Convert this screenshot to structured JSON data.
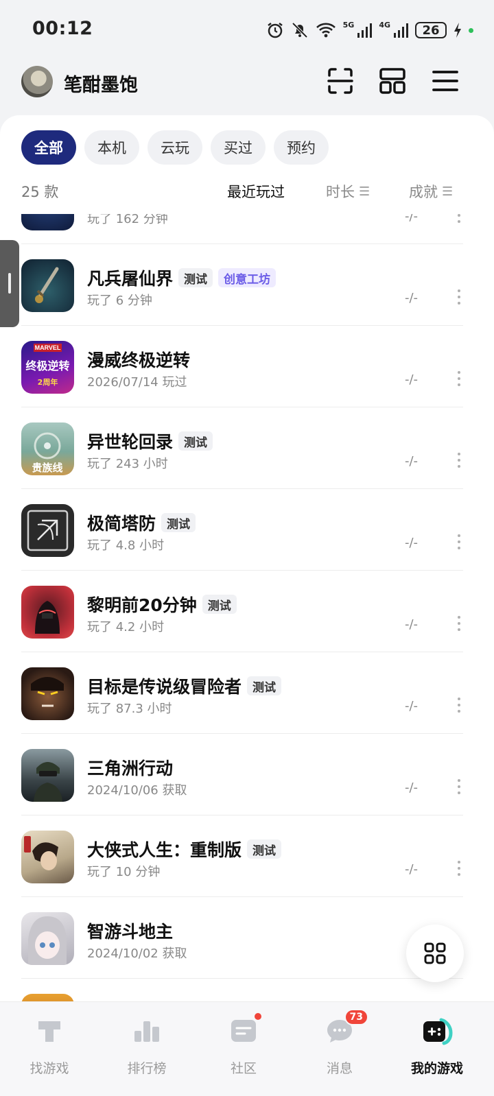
{
  "status_bar": {
    "time": "00:12",
    "battery": "26",
    "net_5g": "5G",
    "net_4g": "4G",
    "icons": [
      "alarm-icon",
      "mute-bell-icon",
      "wifi-icon",
      "signal-5g-icon",
      "signal-4g-icon",
      "battery-icon",
      "charging-icon"
    ]
  },
  "header": {
    "username": "笔酣墨饱",
    "icons": [
      "scan-icon",
      "grid-view-icon",
      "menu-icon"
    ]
  },
  "filters": [
    {
      "label": "全部",
      "active": true
    },
    {
      "label": "本机",
      "active": false
    },
    {
      "label": "云玩",
      "active": false
    },
    {
      "label": "买过",
      "active": false
    },
    {
      "label": "预约",
      "active": false
    }
  ],
  "sortbar": {
    "count": "25 款",
    "recent": "最近玩过",
    "duration": "时长",
    "achievement": "成就"
  },
  "games": [
    {
      "title": "",
      "sub": "玩了 162 分钟",
      "achv": "-/-",
      "tags": []
    },
    {
      "title": "凡兵屠仙界",
      "sub": "玩了 6 分钟",
      "achv": "-/-",
      "tags": [
        "测试",
        "创意工坊"
      ]
    },
    {
      "title": "漫威终极逆转",
      "sub": "2026/07/14 玩过",
      "achv": "-/-",
      "tags": []
    },
    {
      "title": "异世轮回录",
      "sub": "玩了 243 小时",
      "achv": "-/-",
      "tags": [
        "测试"
      ]
    },
    {
      "title": "极简塔防",
      "sub": "玩了 4.8 小时",
      "achv": "-/-",
      "tags": [
        "测试"
      ]
    },
    {
      "title": "黎明前20分钟",
      "sub": "玩了 4.2 小时",
      "achv": "-/-",
      "tags": [
        "测试"
      ]
    },
    {
      "title": "目标是传说级冒险者",
      "sub": "玩了 87.3 小时",
      "achv": "-/-",
      "tags": [
        "测试"
      ]
    },
    {
      "title": "三角洲行动",
      "sub": "2024/10/06 获取",
      "achv": "-/-",
      "tags": []
    },
    {
      "title": "大侠式人生：重制版",
      "sub": "玩了 10 分钟",
      "achv": "-/-",
      "tags": [
        "测试"
      ]
    },
    {
      "title": "智游斗地主",
      "sub": "2024/10/02 获取",
      "achv": "",
      "tags": []
    }
  ],
  "icon_text": {
    "marvel_brand": "MARVEL",
    "marvel_logo": "终极逆转",
    "marvel_anniv": "2周年",
    "lunhui_overlay": "贵族线"
  },
  "bottom_nav": [
    {
      "label": "找游戏",
      "icon": "find-game-icon"
    },
    {
      "label": "排行榜",
      "icon": "ranking-icon"
    },
    {
      "label": "社区",
      "icon": "community-icon"
    },
    {
      "label": "消息",
      "icon": "message-icon",
      "badge": "73"
    },
    {
      "label": "我的游戏",
      "icon": "my-games-icon",
      "active": true
    }
  ],
  "colors": {
    "accent": "#1e2a7d",
    "badge": "#f0453a",
    "tag_purple": "#6b5ce7",
    "teal": "#3fd1c4"
  }
}
